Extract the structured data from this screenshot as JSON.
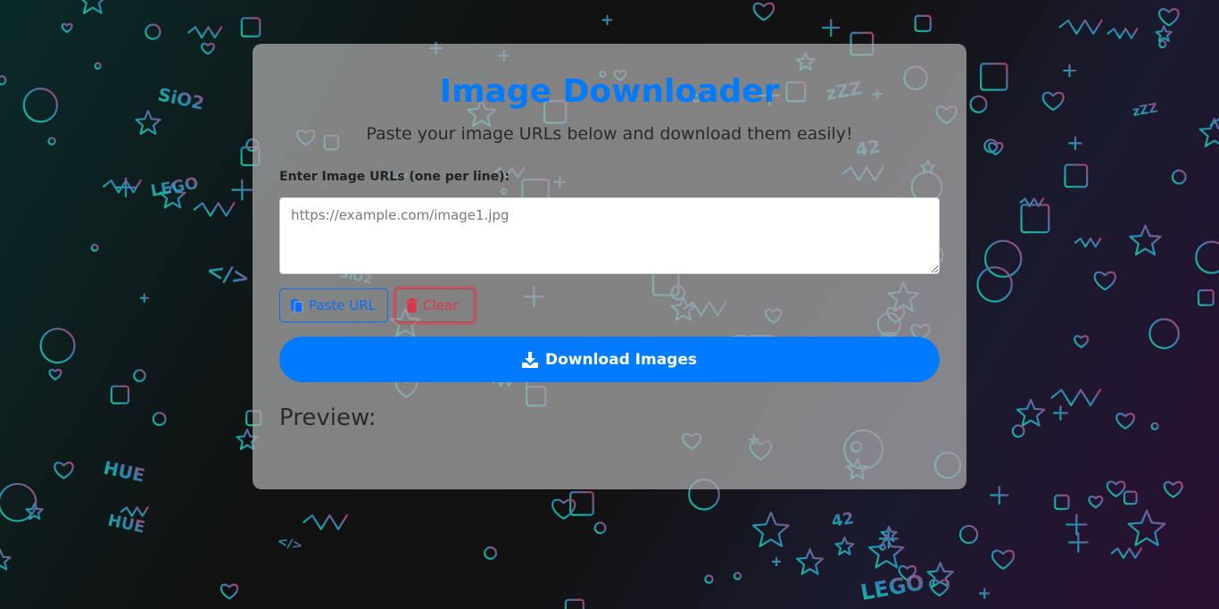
{
  "app": {
    "title": "Image Downloader",
    "subtitle": "Paste your image URLs below and download them easily!"
  },
  "form": {
    "urls_label": "Enter Image URLs (one per line):",
    "urls_value": "",
    "urls_placeholder": "https://example.com/image1.jpg"
  },
  "buttons": {
    "paste_label": "Paste URL",
    "clear_label": "Clear",
    "download_label": "Download Images"
  },
  "preview": {
    "heading": "Preview:"
  },
  "icons": {
    "paste": "clipboard-icon",
    "clear": "trash-icon",
    "download": "download-icon"
  },
  "colors": {
    "primary": "#007bff",
    "danger": "#dc3545",
    "card_background": "#afafaf"
  },
  "background": {
    "doodle_words": [
      "LEGO",
      "HUE",
      "42",
      "SiO2",
      "zZZ",
      "</>"
    ]
  }
}
